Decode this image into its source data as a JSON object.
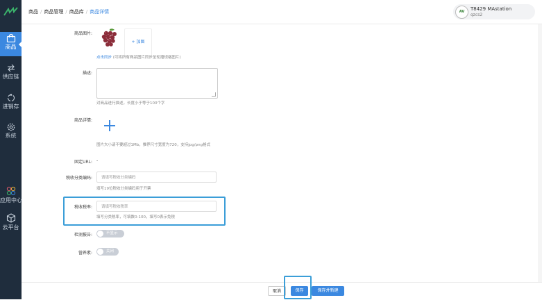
{
  "sidebar": {
    "items": [
      {
        "label": "商品",
        "icon": "shopping-bag-icon",
        "active": true
      },
      {
        "label": "供应链",
        "icon": "exchange-arrows-icon"
      },
      {
        "label": "进销存",
        "icon": "inventory-cycle-icon"
      },
      {
        "label": "系统",
        "icon": "gear-icon"
      },
      {
        "label": "应用中心",
        "icon": "app-center-icon"
      },
      {
        "label": "云平台",
        "icon": "cube-icon"
      }
    ]
  },
  "breadcrumb": [
    "商品",
    "商品管理",
    "商品库",
    "商品详情"
  ],
  "user": {
    "name": "T8429 MAstation",
    "sub": "qzcs2",
    "logo_text": "AV"
  },
  "form": {
    "image_label": "商品图片:",
    "add_image_label": "+ 加图",
    "sync_link": "点击同步",
    "sync_hint": "(可将所有商品图片同步至轮播规格图片)",
    "desc_label": "描述:",
    "desc_value": "",
    "desc_hint": "对商品进行描述，长度小于等于100个字",
    "detail_label": "商品详情:",
    "detail_hint": "图片大小请不要超过1Mb，推荐尺寸宽度为720，支持jpg/png格式",
    "url_label": "固定URL:",
    "url_value": "-",
    "tax_code_label": "税收分类编码:",
    "tax_code_placeholder": "请填写税收分类编码",
    "tax_code_hint": "填写19位税收分类编码用于开票",
    "tax_rate_label": "税收税率:",
    "tax_rate_placeholder": "请填写税收税率",
    "tax_rate_hint": "填写分类税率，可填数0-100，填写0表示免税",
    "inspection_label": "检测报告:",
    "inspection_toggle": "不显示",
    "nutrition_label": "营养素:",
    "nutrition_toggle": "关闭"
  },
  "footer": {
    "cancel": "取消",
    "save": "保存",
    "save_new": "保存并新建"
  },
  "colors": {
    "sidebar_bg": "#1f2d3d",
    "accent": "#3b88e0",
    "highlight": "#3b9ed8"
  }
}
